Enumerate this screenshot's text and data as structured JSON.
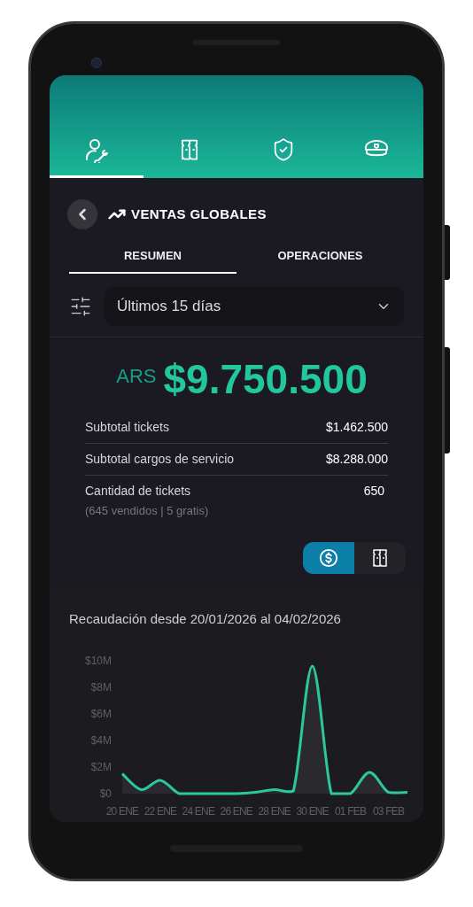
{
  "nav_tabs": [
    {
      "selected": true
    },
    {
      "selected": false
    },
    {
      "selected": false
    },
    {
      "selected": false
    }
  ],
  "title": "VENTAS GLOBALES",
  "sub_tabs": [
    {
      "label": "RESUMEN",
      "selected": true
    },
    {
      "label": "OPERACIONES",
      "selected": false
    }
  ],
  "period_select": {
    "value": "Últimos 15 días"
  },
  "total": {
    "currency": "ARS",
    "amount": "$9.750.500"
  },
  "rows": [
    {
      "label": "Subtotal tickets",
      "value": "$1.462.500"
    },
    {
      "label": "Subtotal cargos de servicio",
      "value": "$8.288.000"
    },
    {
      "label": "Cantidad de tickets",
      "value": "650",
      "note": "(645 vendidos | 5 gratis)"
    }
  ],
  "view_toggle": [
    {
      "selected": true
    },
    {
      "selected": false
    }
  ],
  "chart": {
    "title": "Recaudación desde 20/01/2026 al 04/02/2026",
    "chart_data": {
      "type": "area",
      "categories": [
        "20 ENE",
        null,
        "22 ENE",
        null,
        "24 ENE",
        null,
        "26 ENE",
        null,
        "28 ENE",
        null,
        "30 ENE",
        null,
        "01 FEB",
        null,
        "03 FEB",
        null
      ],
      "series": [
        {
          "color": "#2cc79f",
          "values": [
            1500000,
            300000,
            1000000,
            0,
            0,
            0,
            0,
            100000,
            300000,
            200000,
            9600000,
            0,
            0,
            1600000,
            100000,
            100000
          ]
        }
      ],
      "ylim": [
        0,
        10000000
      ],
      "yticks": [
        {
          "value": 0,
          "label": "$0"
        },
        {
          "value": 2000000,
          "label": "$2M"
        },
        {
          "value": 4000000,
          "label": "$4M"
        },
        {
          "value": 6000000,
          "label": "$6M"
        },
        {
          "value": 8000000,
          "label": "$8M"
        },
        {
          "value": 10000000,
          "label": "$10M"
        }
      ]
    }
  }
}
